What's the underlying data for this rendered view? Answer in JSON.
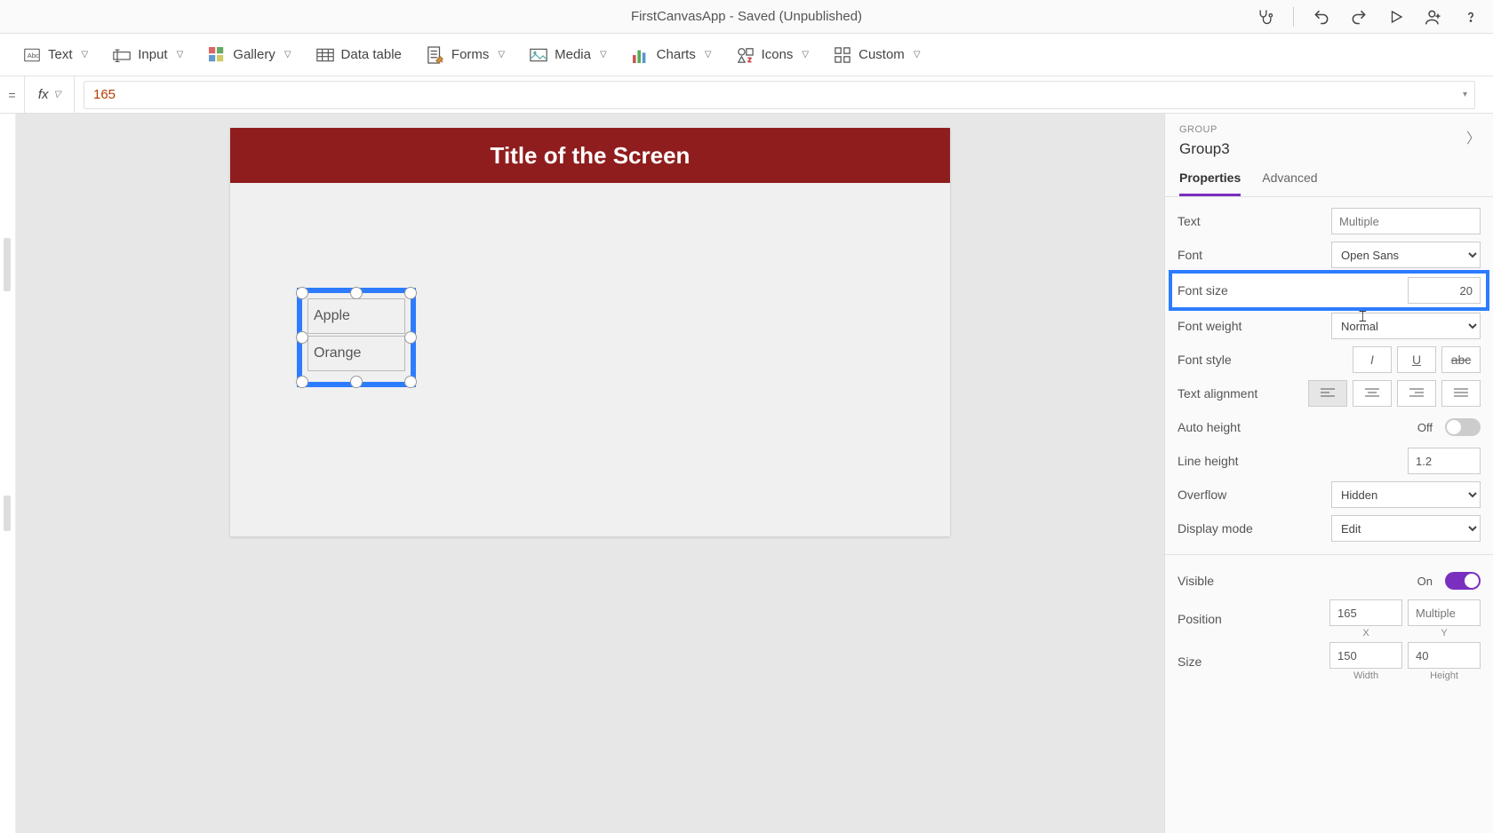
{
  "titlebar": {
    "title": "FirstCanvasApp - Saved (Unpublished)"
  },
  "ribbon": {
    "text": "Text",
    "input": "Input",
    "gallery": "Gallery",
    "datatable": "Data table",
    "forms": "Forms",
    "media": "Media",
    "charts": "Charts",
    "icons": "Icons",
    "custom": "Custom"
  },
  "formula": {
    "eq": "=",
    "fx": "fx",
    "value": "165"
  },
  "canvas": {
    "header_text": "Title of the Screen",
    "item1": "Apple",
    "item2": "Orange"
  },
  "panel": {
    "context": "GROUP",
    "name": "Group3",
    "tabs": {
      "properties": "Properties",
      "advanced": "Advanced"
    },
    "rows": {
      "text": {
        "label": "Text",
        "placeholder": "Multiple"
      },
      "font": {
        "label": "Font",
        "value": "Open Sans"
      },
      "fontsize": {
        "label": "Font size",
        "value": "20"
      },
      "fontweight": {
        "label": "Font weight",
        "value": "Normal"
      },
      "fontstyle": {
        "label": "Font style"
      },
      "textalign": {
        "label": "Text alignment"
      },
      "autoheight": {
        "label": "Auto height",
        "state": "Off"
      },
      "lineheight": {
        "label": "Line height",
        "value": "1.2"
      },
      "overflow": {
        "label": "Overflow",
        "value": "Hidden"
      },
      "displaymode": {
        "label": "Display mode",
        "value": "Edit"
      },
      "visible": {
        "label": "Visible",
        "state": "On"
      },
      "position": {
        "label": "Position",
        "x": "165",
        "xlabel": "X",
        "y_placeholder": "Multiple",
        "ylabel": "Y"
      },
      "size": {
        "label": "Size",
        "w": "150",
        "wlabel": "Width",
        "h": "40",
        "hlabel": "Height"
      }
    }
  }
}
